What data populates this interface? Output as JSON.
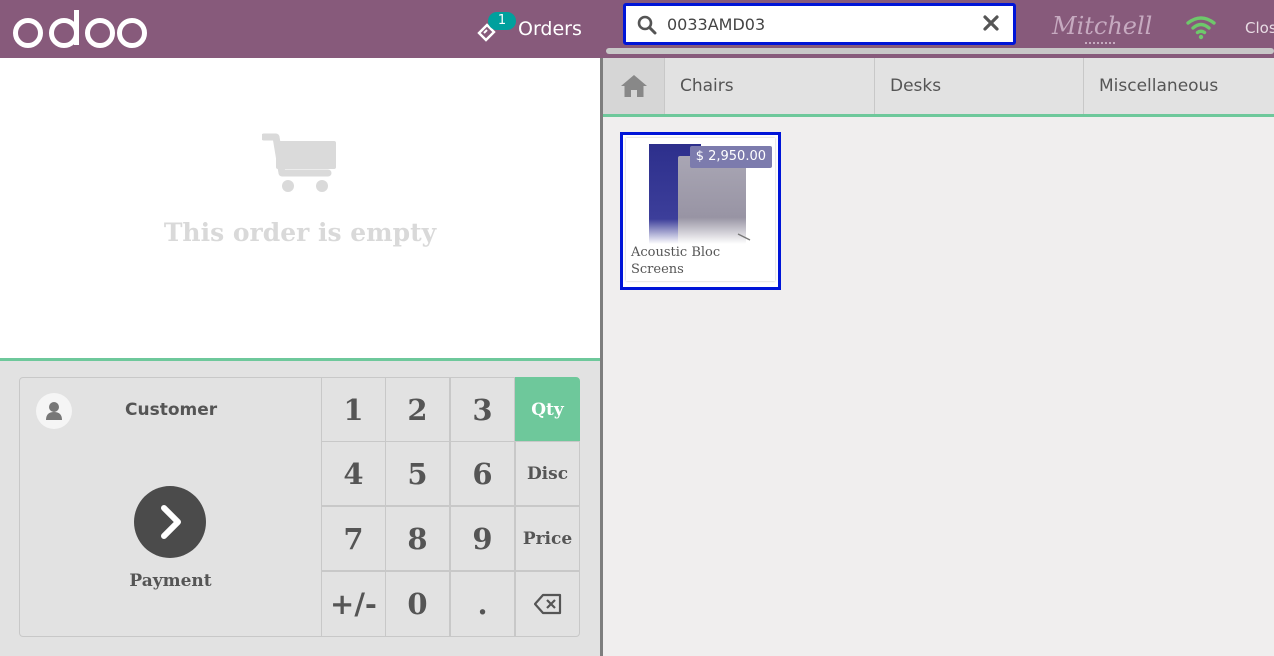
{
  "header": {
    "logo_text": "odoo",
    "orders_label": "Orders",
    "orders_count": "1",
    "search": {
      "value": "0033AMD03",
      "placeholder": ""
    },
    "cashier_name": "Mitchell",
    "close_label": "Close"
  },
  "order": {
    "empty_message": "This order is empty"
  },
  "actions": {
    "customer_label": "Customer",
    "payment_label": "Payment"
  },
  "numpad": {
    "keys": [
      "1",
      "2",
      "3",
      "4",
      "5",
      "6",
      "7",
      "8",
      "9",
      "+/-",
      "0",
      "."
    ],
    "modes": {
      "qty": "Qty",
      "disc": "Disc",
      "price": "Price"
    },
    "active_mode": "Qty"
  },
  "categories": {
    "items": [
      {
        "label": "Chairs"
      },
      {
        "label": "Desks"
      },
      {
        "label": "Miscellaneous"
      }
    ]
  },
  "products": [
    {
      "name": "Acoustic Bloc Screens",
      "price": "$ 2,950.00"
    }
  ],
  "colors": {
    "brand": "#875a7b",
    "accent": "#6ec89b",
    "focus": "#0015d8",
    "price_tag": "#7c7bad",
    "badge": "#00a09d"
  }
}
